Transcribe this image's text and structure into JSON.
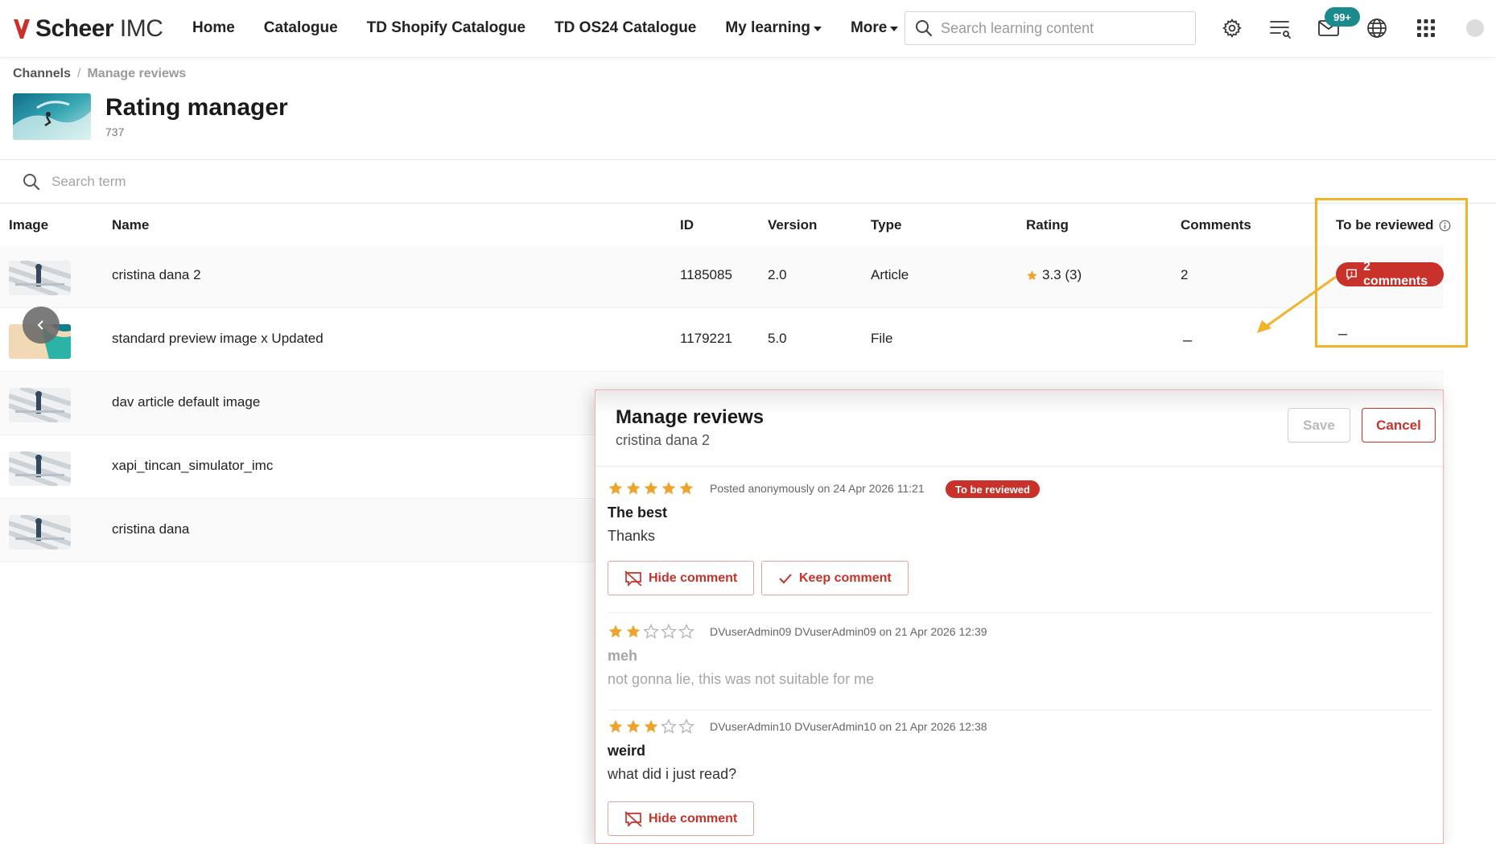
{
  "brand": {
    "name_bold": "Scheer",
    "name_light": " IMC",
    "accent": "#c8322a"
  },
  "nav": {
    "items": [
      {
        "label": "Home",
        "dropdown": false
      },
      {
        "label": "Catalogue",
        "dropdown": false
      },
      {
        "label": "TD Shopify Catalogue",
        "dropdown": false
      },
      {
        "label": "TD OS24 Catalogue",
        "dropdown": false
      },
      {
        "label": "My learning",
        "dropdown": true
      },
      {
        "label": "More",
        "dropdown": true
      }
    ],
    "search_placeholder": "Search learning content",
    "messages_badge": "99+",
    "icons": [
      "gear-icon",
      "task-list-icon",
      "mail-icon",
      "globe-icon",
      "app-grid-icon",
      "user-avatar-icon"
    ]
  },
  "breadcrumb": {
    "root": "Channels",
    "current": "Manage reviews"
  },
  "header": {
    "title": "Rating manager",
    "count": "737"
  },
  "table": {
    "search_placeholder": "Search term",
    "columns": {
      "image": "Image",
      "name": "Name",
      "id": "ID",
      "version": "Version",
      "type": "Type",
      "rating": "Rating",
      "comments": "Comments",
      "to_review": "To be reviewed"
    },
    "rows": [
      {
        "name": "cristina dana 2",
        "id": "1185085",
        "version": "2.0",
        "type": "Article",
        "rating": "3.3 (3)",
        "comments": "2",
        "to_review": "2 comments"
      },
      {
        "name": "standard preview image x Updated",
        "id": "1179221",
        "version": "5.0",
        "type": "File",
        "rating": "",
        "comments": "–",
        "to_review": "–"
      },
      {
        "name": "dav article default image",
        "id": "",
        "version": "",
        "type": "",
        "rating": "",
        "comments": "",
        "to_review": ""
      },
      {
        "name": "xapi_tincan_simulator_imc",
        "id": "",
        "version": "",
        "type": "",
        "rating": "",
        "comments": "",
        "to_review": ""
      },
      {
        "name": "cristina dana",
        "id": "",
        "version": "",
        "type": "",
        "rating": "",
        "comments": "",
        "to_review": ""
      }
    ]
  },
  "modal": {
    "title": "Manage reviews",
    "subtitle": "cristina dana 2",
    "save_label": "Save",
    "cancel_label": "Cancel",
    "reviews": [
      {
        "stars": 5,
        "meta": "Posted anonymously on 24 Apr 2026 11:21",
        "status": "To be reviewed",
        "title": "The best",
        "text": "Thanks",
        "hide_label": "Hide comment",
        "keep_label": "Keep comment"
      },
      {
        "stars": 2,
        "meta": "DVuserAdmin09 DVuserAdmin09 on 21 Apr 2026 12:39",
        "title": "meh",
        "text": "not gonna lie, this was not suitable for me"
      },
      {
        "stars": 3,
        "meta": "DVuserAdmin10 DVuserAdmin10 on 21 Apr 2026 12:38",
        "title": "weird",
        "text": "what did i just read?",
        "hide_label": "Hide comment"
      }
    ]
  },
  "colors": {
    "star": "#f0a32a",
    "star_empty": "#b5b5b5",
    "badge_teal": "#1a8a8c",
    "highlight": "#f0b429"
  }
}
